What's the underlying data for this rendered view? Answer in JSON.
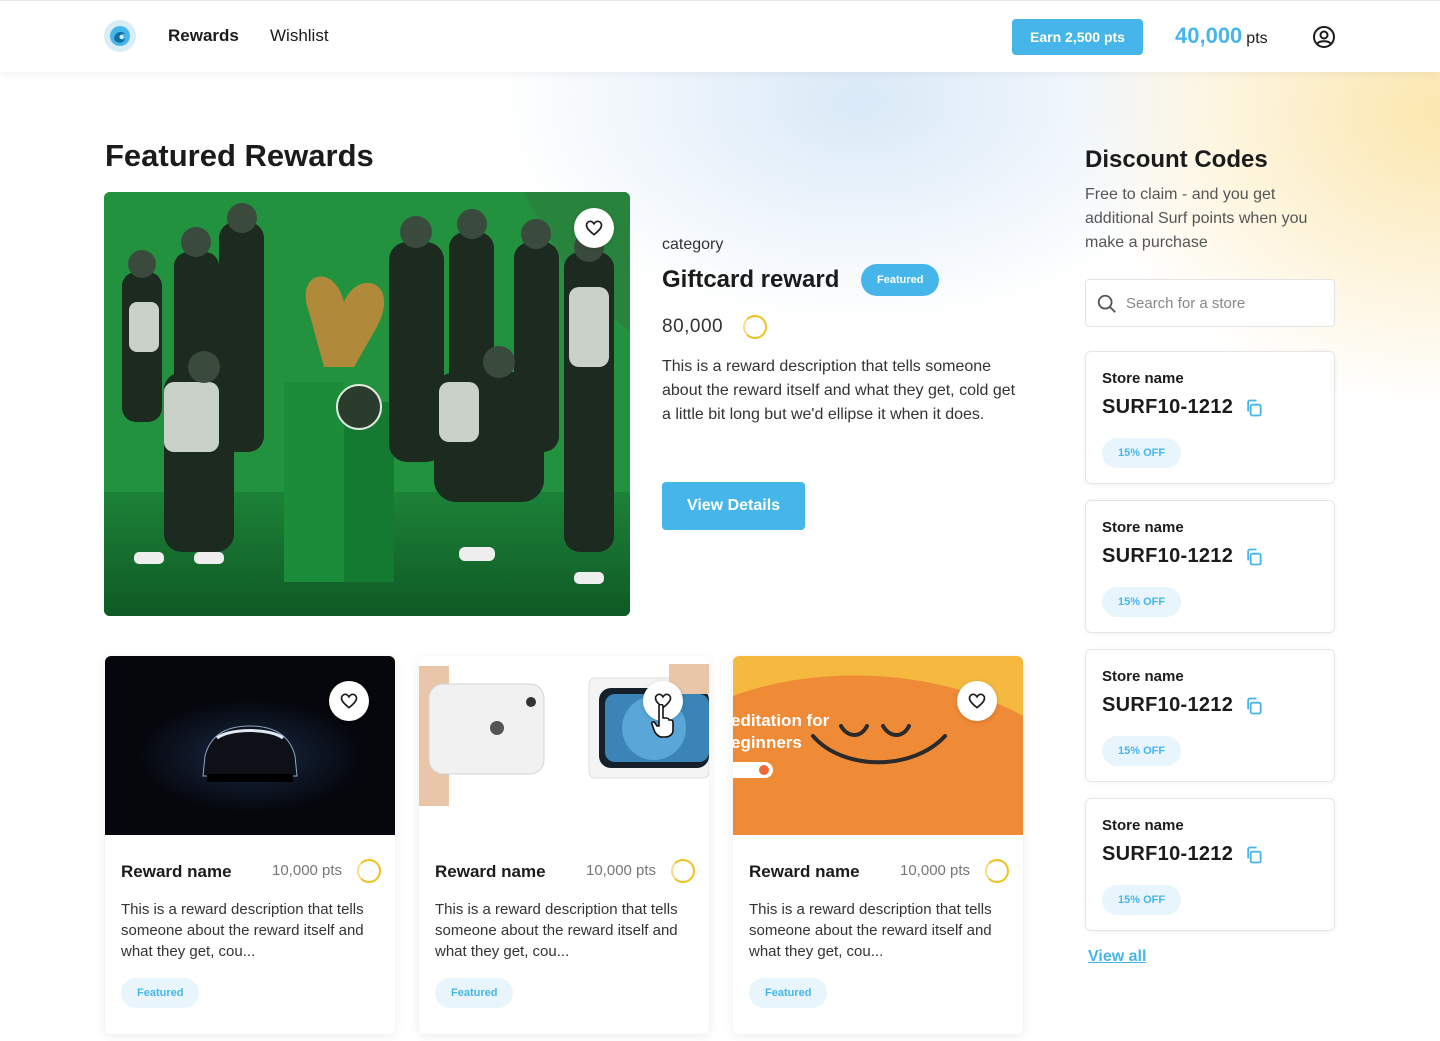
{
  "colors": {
    "accent": "#46b6ea",
    "accent_soft": "#e8f5fc",
    "points_ring": "#f2c01e",
    "text": "#1b1b1b"
  },
  "header": {
    "nav": {
      "rewards": "Rewards",
      "wishlist": "Wishlist"
    },
    "earn_button": "Earn 2,500 pts",
    "points_value": "40,000",
    "points_unit": "pts",
    "icons": {
      "logo": "surf-logo-icon",
      "profile": "user-circle-icon"
    }
  },
  "featured": {
    "title": "Featured Rewards",
    "hero": {
      "image": "team-green-kit-photo",
      "category": "category",
      "name": "Giftcard reward",
      "badge": "Featured",
      "price": "80,000",
      "description": "This is a reward description that tells someone about the reward itself and what they get, cold get a little bit long but we'd ellipse it when it does.",
      "button": "View Details"
    },
    "cards": [
      {
        "image": "car-dark-photo",
        "name": "Reward name",
        "points": "10,000 pts",
        "description": "This is a reward description that tells someone about the reward itself and what they get, cou...",
        "badge": "Featured"
      },
      {
        "image": "phone-unboxing-photo",
        "name": "Reward name",
        "points": "10,000 pts",
        "description": "This is a reward description that tells someone about the reward itself and what they get, cou...",
        "badge": "Featured"
      },
      {
        "image": "meditation-banner",
        "image_text_1": "editation for",
        "image_text_2": "eginners",
        "name": "Reward name",
        "points": "10,000 pts",
        "description": "This is a reward description that tells someone about the reward itself and what they get, cou...",
        "badge": "Featured"
      }
    ]
  },
  "discount": {
    "title": "Discount Codes",
    "subtitle": "Free to claim - and you get additional Surf points when you make a purchase",
    "search_placeholder": "Search for a store",
    "codes": [
      {
        "store": "Store name",
        "code": "SURF10-1212",
        "badge": "15% OFF"
      },
      {
        "store": "Store name",
        "code": "SURF10-1212",
        "badge": "15% OFF"
      },
      {
        "store": "Store name",
        "code": "SURF10-1212",
        "badge": "15% OFF"
      },
      {
        "store": "Store name",
        "code": "SURF10-1212",
        "badge": "15% OFF"
      }
    ],
    "view_all": "View all"
  }
}
